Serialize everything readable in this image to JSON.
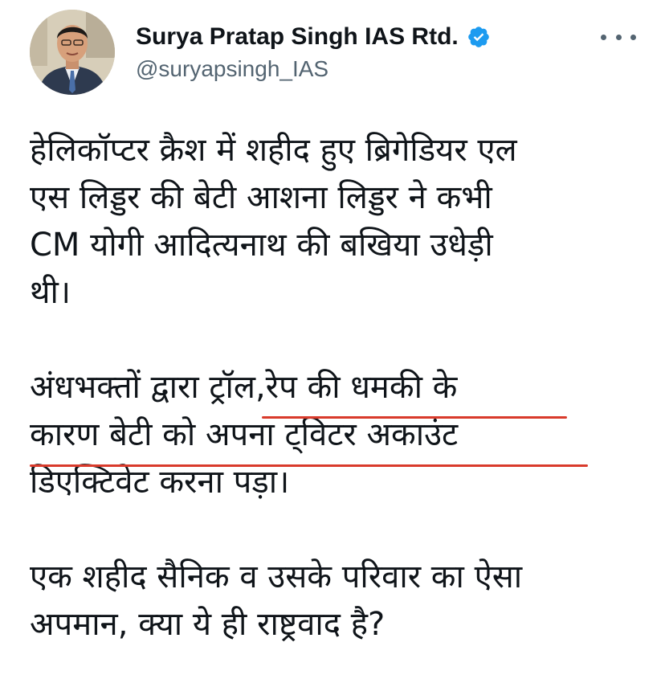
{
  "tweet": {
    "author": {
      "name": "Surya Pratap Singh IAS Rtd.",
      "handle": "@suryapsingh_IAS",
      "verified_icon": "verified-badge-icon",
      "avatar_icon": "profile-photo"
    },
    "more_icon": "more-options-icon",
    "paragraphs": [
      "हेलिकॉप्टर क्रैश में शहीद हुए ब्रिगेडियर एल\nएस लिड्डर की बेटी आशना लिड्डर ने कभी\nCM योगी आदित्यनाथ की बखिया उधेड़ी\nथी।",
      "अंधभक्तों द्वारा ट्रॉल,रेप की धमकी के\nकारण बेटी को अपना ट्विटर अकाउंट\nडिएक्टिवेट करना पड़ा।",
      "एक शहीद सैनिक व उसके परिवार का ऐसा\nअपमान, क्या ये ही राष्ट्रवाद है?"
    ],
    "highlight_color": "#d93a2b"
  }
}
